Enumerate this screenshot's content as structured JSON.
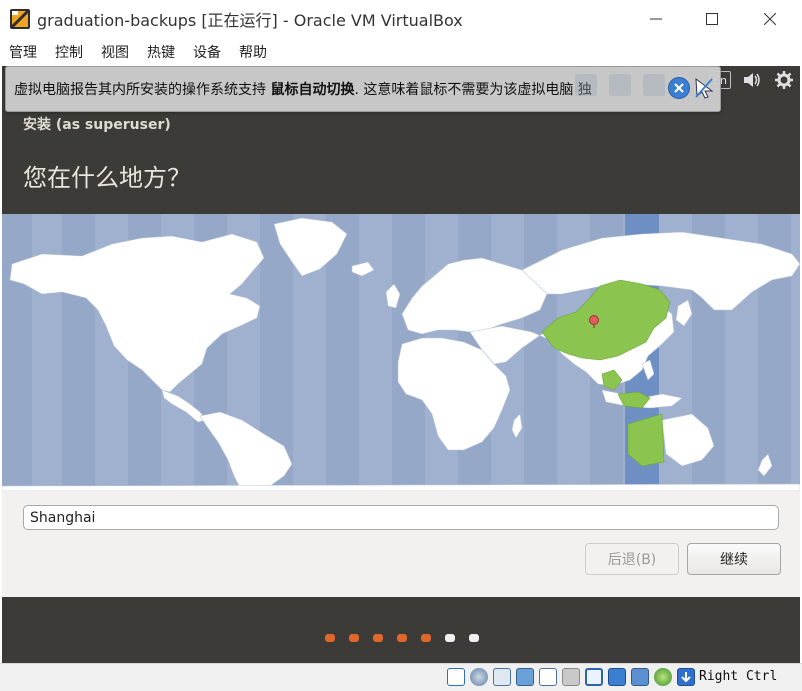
{
  "window": {
    "title": "graduation-backups [正在运行] - Oracle VM VirtualBox"
  },
  "menu": {
    "items": [
      "管理",
      "控制",
      "视图",
      "热键",
      "设备",
      "帮助"
    ]
  },
  "notification": {
    "text_before": "虚拟电脑报告其内所安装的操作系统支持 ",
    "text_bold": "鼠标自动切换",
    "text_after": ". 这意味着鼠标不需要为该虚拟电脑 独"
  },
  "topbar": {
    "keyboard_indicator": "En"
  },
  "installer": {
    "window_title": "安装 (as superuser)",
    "heading": "您在什么地方？",
    "city_value": "Shanghai",
    "back_label": "后退(B)",
    "continue_label": "继续"
  },
  "progress": {
    "total_steps": 7,
    "completed_steps": 5,
    "active_color": "#e0682b",
    "inactive_color": "#f0f0f0"
  },
  "statusbar": {
    "host_key": "Right Ctrl"
  },
  "colors": {
    "ubuntu_dark": "#3c3b37",
    "map_ocean": "#9fb1cf",
    "selected_timezone": "#8bc44e",
    "land": "#ffffff"
  }
}
